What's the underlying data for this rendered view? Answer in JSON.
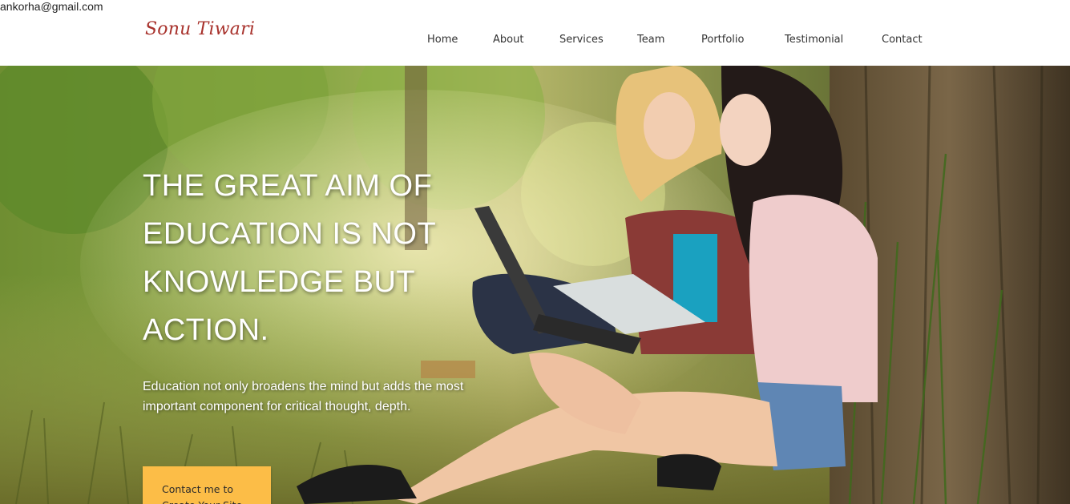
{
  "top_bar": {
    "email": "ankorha@gmail.com"
  },
  "header": {
    "logo": "Sonu Tiwari",
    "nav": [
      "Home",
      "About",
      "Services",
      "Team",
      "Portfolio",
      "Testimonial",
      "Contact"
    ]
  },
  "hero": {
    "headline": "THE GREAT AIM OF EDUCATION IS NOT KNOWLEDGE BUT ACTION.",
    "subtext": "Education not only broadens the mind but adds the most important component for critical thought, depth.",
    "cta_line1": "Contact me to",
    "cta_line2": "Create Your Site"
  },
  "colors": {
    "logo": "#a8322c",
    "cta_background": "#fcbd47",
    "header_background": "#ffffff"
  }
}
